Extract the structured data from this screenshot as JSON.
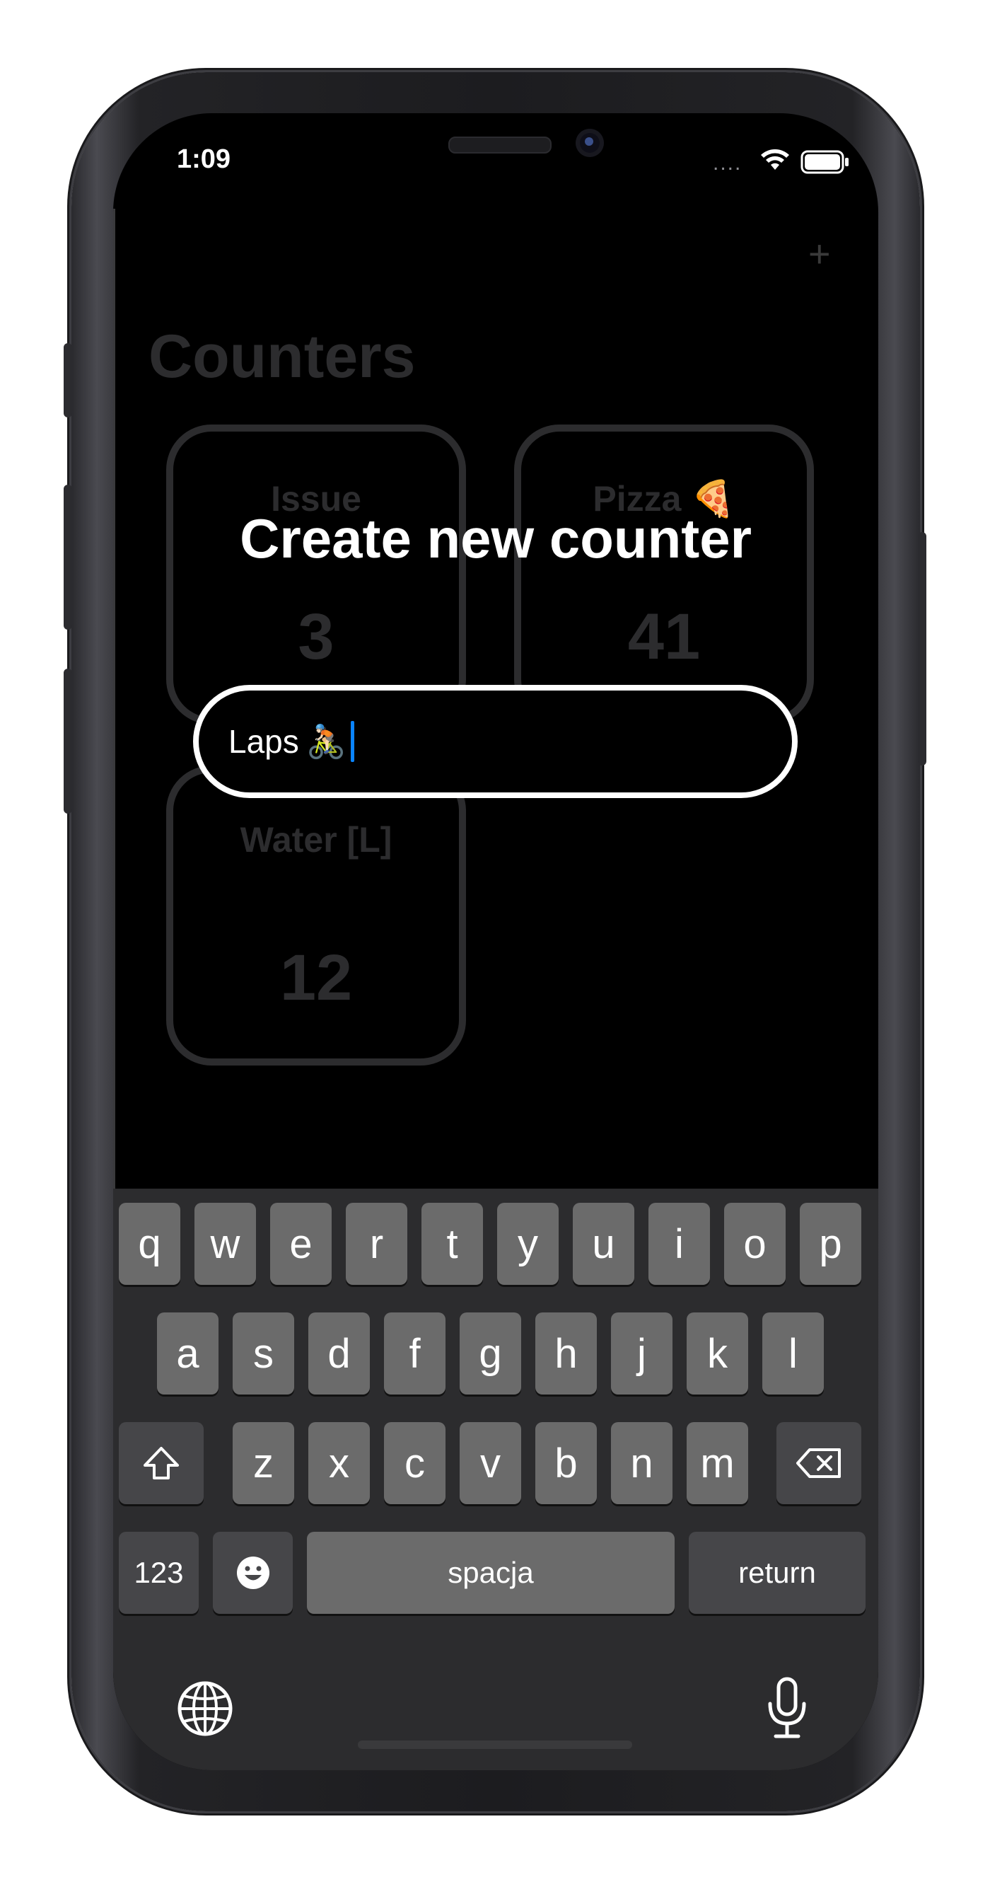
{
  "status_bar": {
    "time": "1:09",
    "signal": "....",
    "wifi_icon": "wifi-icon",
    "battery_icon": "battery-icon"
  },
  "background_app": {
    "add_label": "+",
    "title": "Counters",
    "counters": [
      {
        "name": "Issue",
        "value": "3"
      },
      {
        "name": "Pizza 🍕",
        "value": "41"
      },
      {
        "name": "Water [L]",
        "value": "12"
      }
    ]
  },
  "modal": {
    "title": "Create new counter",
    "field_value": "Laps",
    "field_emoji": "🚴🏻"
  },
  "keyboard": {
    "row1": [
      "q",
      "w",
      "e",
      "r",
      "t",
      "y",
      "u",
      "i",
      "o",
      "p"
    ],
    "row2": [
      "a",
      "s",
      "d",
      "f",
      "g",
      "h",
      "j",
      "k",
      "l"
    ],
    "row3": [
      "z",
      "x",
      "c",
      "v",
      "b",
      "n",
      "m"
    ],
    "numbers_label": "123",
    "space_label": "spacja",
    "return_label": "return"
  },
  "colors": {
    "caret": "#0a84ff",
    "key": "#6b6b6b",
    "function_key": "#464649",
    "keyboard_bg": "#2c2c2e"
  }
}
